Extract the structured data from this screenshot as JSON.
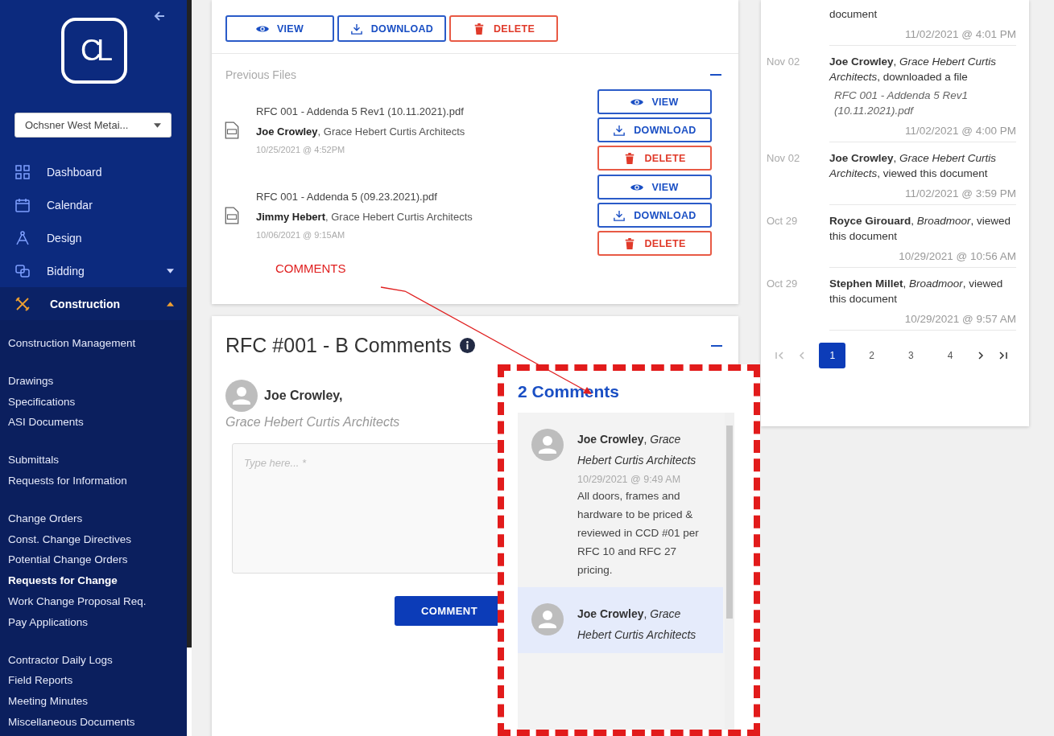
{
  "sidebar": {
    "logo": "CL",
    "project_select": {
      "value": "Ochsner West Metai..."
    },
    "nav": [
      {
        "label": "Dashboard",
        "kind": "link",
        "selected": false
      },
      {
        "label": "Calendar",
        "kind": "link",
        "selected": false
      },
      {
        "label": "Design",
        "kind": "link",
        "selected": false
      },
      {
        "label": "Bidding",
        "kind": "menu",
        "selected": false,
        "expanded": false
      },
      {
        "label": "Construction",
        "kind": "menu",
        "selected": true,
        "expanded": true
      }
    ],
    "submenu_groups": [
      [
        {
          "label": "Construction Management",
          "selected": false
        }
      ],
      [
        {
          "label": "Drawings",
          "selected": false
        },
        {
          "label": "Specifications",
          "selected": false
        },
        {
          "label": "ASI Documents",
          "selected": false
        }
      ],
      [
        {
          "label": "Submittals",
          "selected": false
        },
        {
          "label": "Requests for Information",
          "selected": false
        }
      ],
      [
        {
          "label": "Change Orders",
          "selected": false
        },
        {
          "label": "Const. Change Directives",
          "selected": false
        },
        {
          "label": "Potential Change Orders",
          "selected": false
        },
        {
          "label": "Requests for Change",
          "selected": true
        },
        {
          "label": "Work Change Proposal Req.",
          "selected": false
        },
        {
          "label": "Pay Applications",
          "selected": false
        }
      ],
      [
        {
          "label": "Contractor Daily Logs",
          "selected": false
        },
        {
          "label": "Field Reports",
          "selected": false
        },
        {
          "label": "Meeting Minutes",
          "selected": false
        },
        {
          "label": "Miscellaneous Documents",
          "selected": false
        }
      ]
    ]
  },
  "files_card": {
    "actions": [
      {
        "kind": "view",
        "label": "VIEW"
      },
      {
        "kind": "download",
        "label": "DOWNLOAD"
      },
      {
        "kind": "delete",
        "label": "DELETE"
      }
    ],
    "section_title": "Previous Files",
    "files": [
      {
        "name": "RFC 001 - Addenda 5 Rev1 (10.11.2021).pdf",
        "author": "Joe Crowley",
        "company": ", Grace Hebert Curtis Architects",
        "date": "10/25/2021 @ 4:52PM",
        "actions": [
          {
            "kind": "view",
            "label": "VIEW"
          },
          {
            "kind": "download",
            "label": "DOWNLOAD"
          },
          {
            "kind": "delete",
            "label": "DELETE"
          }
        ]
      },
      {
        "name": "RFC 001 - Addenda 5 (09.23.2021).pdf",
        "author": "Jimmy Hebert",
        "company": ", Grace Hebert Curtis Architects",
        "date": "10/06/2021 @ 9:15AM",
        "actions": [
          {
            "kind": "view",
            "label": "VIEW"
          },
          {
            "kind": "download",
            "label": "DOWNLOAD"
          },
          {
            "kind": "delete",
            "label": "DELETE"
          }
        ]
      }
    ]
  },
  "annotation": {
    "label": "COMMENTS"
  },
  "comments_card": {
    "title": "RFC #001 - B Comments",
    "user": {
      "name": "Joe Crowley,",
      "company": "Grace Hebert Curtis Architects"
    },
    "input": {
      "placeholder": "Type here... *"
    },
    "button": "COMMENT"
  },
  "comments_popup": {
    "heading": "2 Comments",
    "comments": [
      {
        "author": "**Joe Crowley**, *Grace Hebert Curtis Architects*",
        "time": "10/29/2021 @ 9:49 AM",
        "text": "All doors, frames and hardware to be priced & reviewed in CCD #01 per RFC 10 and RFC 27 pricing.",
        "selected": false
      },
      {
        "author": "**Joe Crowley**, *Grace Hebert Curtis Architects*",
        "selected": true
      }
    ]
  },
  "activity": {
    "items": [
      {
        "kind": "partial",
        "text": "document",
        "time": "11/02/2021 @ 4:01 PM"
      },
      {
        "kind": "event",
        "date": "Nov 02",
        "text": "**Joe Crowley**, *Grace Hebert Curtis Architects*, downloaded a file",
        "file": "RFC 001 - Addenda 5 Rev1 (10.11.2021).pdf",
        "time": "11/02/2021 @ 4:00 PM"
      },
      {
        "kind": "event",
        "date": "Nov 02",
        "text": "**Joe Crowley**, *Grace Hebert Curtis Architects*, viewed this document",
        "time": "11/02/2021 @ 3:59 PM"
      },
      {
        "kind": "event",
        "date": "Oct 29",
        "text": "**Royce Girouard**, *Broadmoor*, viewed this document",
        "time": "10/29/2021 @ 10:56 AM"
      },
      {
        "kind": "event",
        "date": "Oct 29",
        "text": "**Stephen Millet**, *Broadmoor*, viewed this document",
        "time": "10/29/2021 @ 9:57 AM"
      }
    ],
    "pages": [
      {
        "label": "1",
        "selected": true
      },
      {
        "label": "2",
        "selected": false
      },
      {
        "label": "3",
        "selected": false
      },
      {
        "label": "4",
        "selected": false
      }
    ]
  }
}
